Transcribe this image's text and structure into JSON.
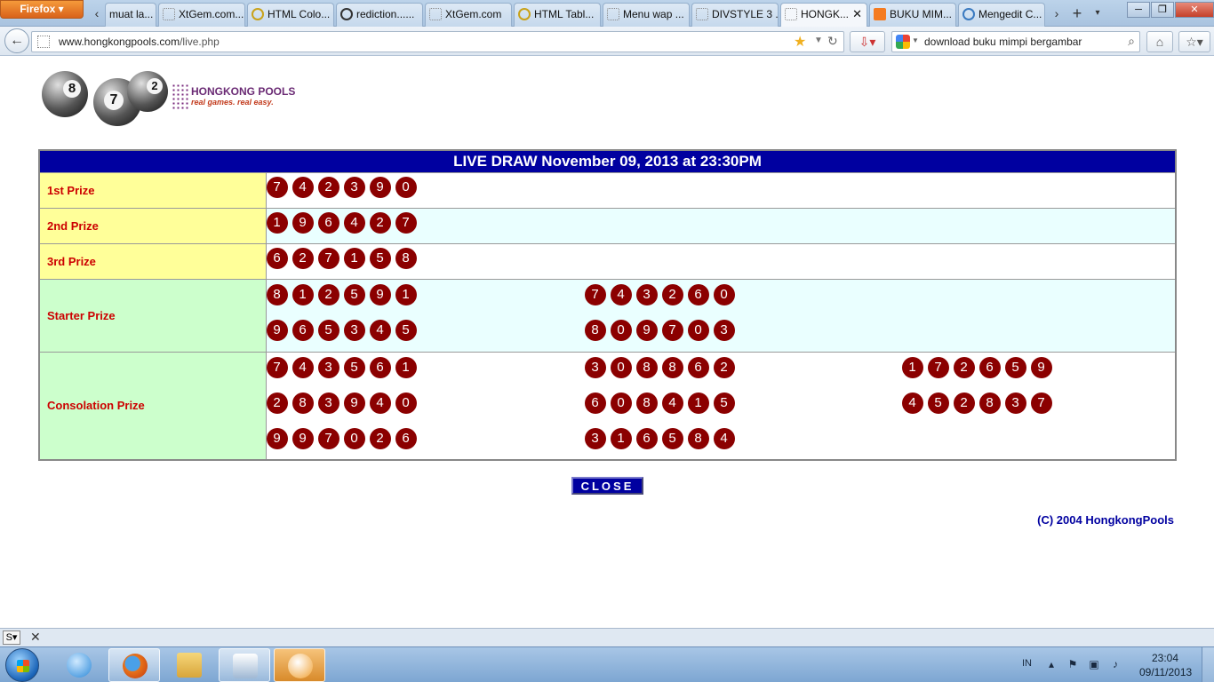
{
  "browser": {
    "app_button": "Firefox ▾",
    "tabs": [
      {
        "label": "muat la..."
      },
      {
        "label": "XtGem.com..."
      },
      {
        "label": "HTML Colo..."
      },
      {
        "label": "rediction......"
      },
      {
        "label": "XtGem.com"
      },
      {
        "label": "HTML Tabl..."
      },
      {
        "label": "Menu wap ..."
      },
      {
        "label": "DIVSTYLE 3 ..."
      },
      {
        "label": "HONGK..."
      },
      {
        "label": "BUKU MIM..."
      },
      {
        "label": "Mengedit C..."
      }
    ],
    "url_host": "www.hongkongpools.com",
    "url_path": "/live.php",
    "search_value": "download buku mimpi bergambar"
  },
  "page": {
    "logo_name": "HONGKONG POOLS",
    "logo_tagline": "real games. real easy.",
    "logo_balls": [
      "8",
      "7",
      "2"
    ],
    "title": "LIVE DRAW  November 09, 2013 at 23:30PM",
    "prizes": {
      "first": {
        "label": "1st Prize",
        "sets": [
          [
            "7",
            "4",
            "2",
            "3",
            "9",
            "0"
          ]
        ]
      },
      "second": {
        "label": "2nd Prize",
        "sets": [
          [
            "1",
            "9",
            "6",
            "4",
            "2",
            "7"
          ]
        ]
      },
      "third": {
        "label": "3rd Prize",
        "sets": [
          [
            "6",
            "2",
            "7",
            "1",
            "5",
            "8"
          ]
        ]
      },
      "starter": {
        "label": "Starter Prize",
        "sets": [
          [
            "8",
            "1",
            "2",
            "5",
            "9",
            "1"
          ],
          [
            "7",
            "4",
            "3",
            "2",
            "6",
            "0"
          ],
          [
            "9",
            "6",
            "5",
            "3",
            "4",
            "5"
          ],
          [
            "8",
            "0",
            "9",
            "7",
            "0",
            "3"
          ]
        ]
      },
      "consolation": {
        "label": "Consolation Prize",
        "sets": [
          [
            "7",
            "4",
            "3",
            "5",
            "6",
            "1"
          ],
          [
            "3",
            "0",
            "8",
            "8",
            "6",
            "2"
          ],
          [
            "1",
            "7",
            "2",
            "6",
            "5",
            "9"
          ],
          [
            "2",
            "8",
            "3",
            "9",
            "4",
            "0"
          ],
          [
            "6",
            "0",
            "8",
            "4",
            "1",
            "5"
          ],
          [
            "4",
            "5",
            "2",
            "8",
            "3",
            "7"
          ],
          [
            "9",
            "9",
            "7",
            "0",
            "2",
            "6"
          ],
          [
            "3",
            "1",
            "6",
            "5",
            "8",
            "4"
          ]
        ]
      }
    },
    "close_label": "CLOSE",
    "copyright": "(C) 2004 HongkongPools"
  },
  "taskbar": {
    "lang": "IN",
    "time": "23:04",
    "date": "09/11/2013"
  },
  "colors": {
    "header_blue": "#0000a0",
    "ball_red": "#8b0000",
    "label_red": "#cc0000",
    "yellow_cell": "#ffff99",
    "green_cell": "#ccffcc"
  }
}
